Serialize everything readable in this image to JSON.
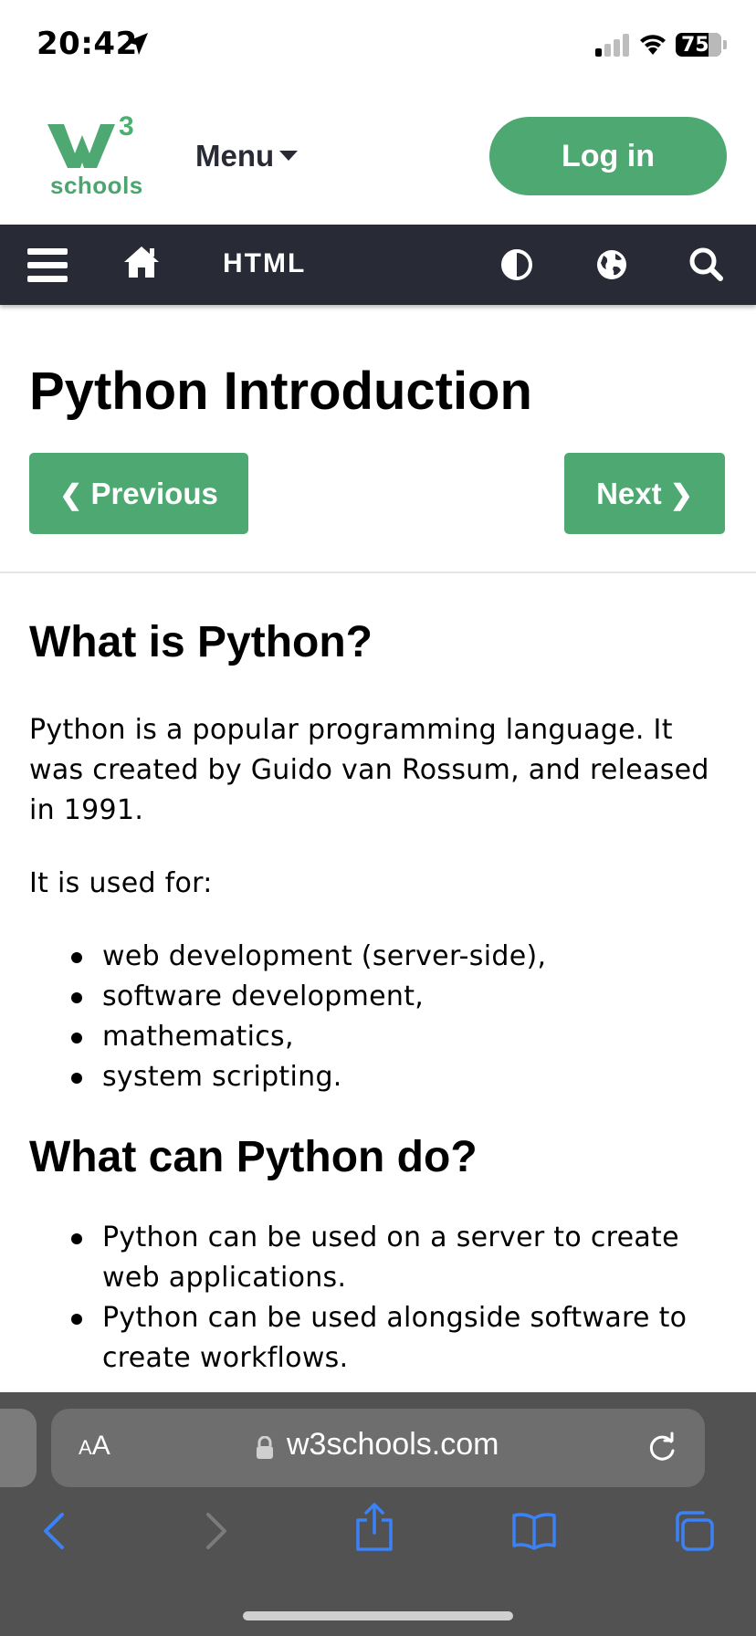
{
  "status_bar": {
    "time": "20:42",
    "battery": "75"
  },
  "header": {
    "logo_superscript": "3",
    "logo_text": "schools",
    "menu_label": "Menu",
    "login_label": "Log in"
  },
  "topnav": {
    "section_label": "HTML"
  },
  "page": {
    "title": "Python Introduction",
    "prev_label": "Previous",
    "next_label": "Next",
    "section1_heading": "What is Python?",
    "section1_para1": "Python is a popular programming language. It was created by Guido van Rossum, and released in 1991.",
    "section1_para2": "It is used for:",
    "uses": [
      "web development (server-side),",
      "software development,",
      "mathematics,",
      "system scripting."
    ],
    "section2_heading": "What can Python do?",
    "capabilities": [
      "Python can be used on a server to create web applications.",
      "Python can be used alongside software to create workflows."
    ]
  },
  "browser": {
    "text_size_label_big": "A",
    "text_size_label_small": "A",
    "url": "w3schools.com"
  },
  "colors": {
    "brand_green": "#4ea872",
    "nav_dark": "#282a35"
  }
}
